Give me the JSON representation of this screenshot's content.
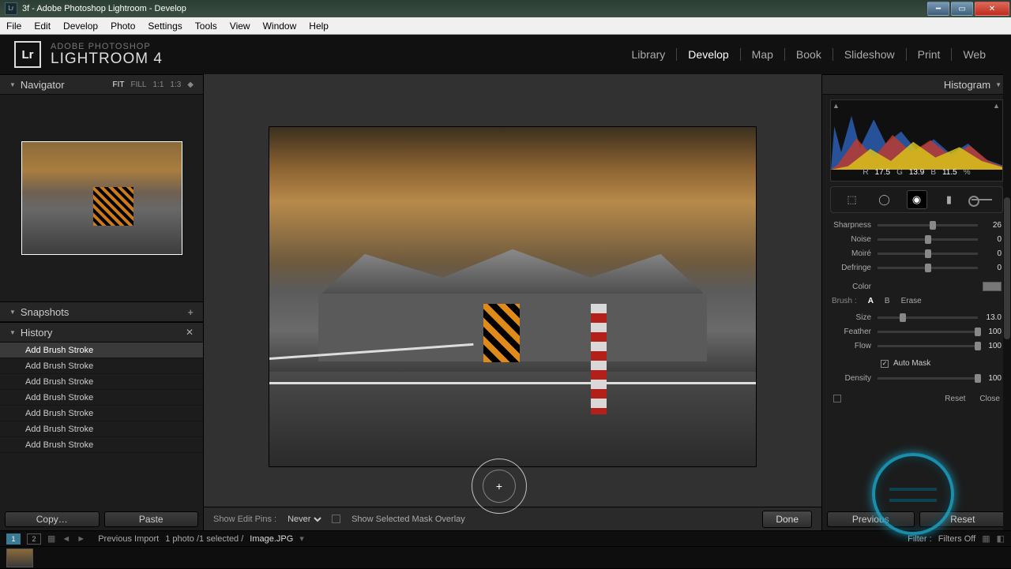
{
  "window": {
    "title": "3f - Adobe Photoshop Lightroom - Develop",
    "app_icon": "Lr"
  },
  "menu": [
    "File",
    "Edit",
    "Develop",
    "Photo",
    "Settings",
    "Tools",
    "View",
    "Window",
    "Help"
  ],
  "identity": {
    "top": "ADOBE PHOTOSHOP",
    "bottom": "LIGHTROOM 4",
    "badge": "Lr"
  },
  "modules": {
    "items": [
      "Library",
      "Develop",
      "Map",
      "Book",
      "Slideshow",
      "Print",
      "Web"
    ],
    "active": "Develop"
  },
  "navigator": {
    "title": "Navigator",
    "zoom": [
      "FIT",
      "FILL",
      "1:1",
      "1:3"
    ],
    "zoom_active": "FIT"
  },
  "snapshots": {
    "title": "Snapshots"
  },
  "history": {
    "title": "History",
    "items": [
      "Add Brush Stroke",
      "Add Brush Stroke",
      "Add Brush Stroke",
      "Add Brush Stroke",
      "Add Brush Stroke",
      "Add Brush Stroke",
      "Add Brush Stroke"
    ]
  },
  "copypaste": {
    "copy": "Copy…",
    "paste": "Paste"
  },
  "tool_options": {
    "label": "Show Edit Pins :",
    "value": "Never",
    "mask_label": "Show Selected Mask Overlay",
    "done": "Done"
  },
  "histogram": {
    "title": "Histogram",
    "r_lbl": "R",
    "r": "17.5",
    "g_lbl": "G",
    "g": "13.9",
    "b_lbl": "B",
    "b": "11.5",
    "pct": "%"
  },
  "toolstrip": {
    "crop": "crop-icon",
    "spot": "spot-removal-icon",
    "redeye": "redeye-icon",
    "grad": "graduated-filter-icon",
    "brush": "adjustment-brush-icon"
  },
  "sliders1": [
    {
      "label": "Sharpness",
      "value": "26",
      "pos": 55
    },
    {
      "label": "Noise",
      "value": "0",
      "pos": 50
    },
    {
      "label": "Moiré",
      "value": "0",
      "pos": 50
    },
    {
      "label": "Defringe",
      "value": "0",
      "pos": 50
    }
  ],
  "color_row": {
    "label": "Color"
  },
  "brush_tabs": {
    "label": "Brush :",
    "a": "A",
    "b": "B",
    "erase": "Erase",
    "active": "A"
  },
  "sliders2": [
    {
      "label": "Size",
      "value": "13.0",
      "pos": 25
    },
    {
      "label": "Feather",
      "value": "100",
      "pos": 100
    },
    {
      "label": "Flow",
      "value": "100",
      "pos": 100
    }
  ],
  "automask": {
    "label": "Auto Mask",
    "checked": true
  },
  "density": {
    "label": "Density",
    "value": "100",
    "pos": 100
  },
  "reset_close": {
    "reset": "Reset",
    "close": "Close"
  },
  "prevnext": {
    "prev": "Previous",
    "reset": "Reset"
  },
  "filmstrip": {
    "pages": [
      "1",
      "2"
    ],
    "page_active": "1",
    "source": "Previous Import",
    "count": "1 photo /1 selected /",
    "filename": "Image.JPG",
    "filter_lbl": "Filter :",
    "filter_val": "Filters Off"
  }
}
